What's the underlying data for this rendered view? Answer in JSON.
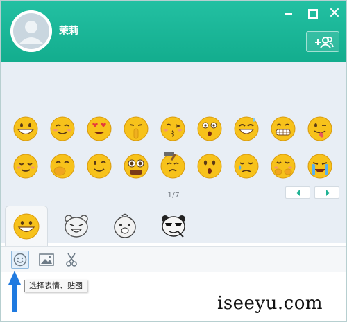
{
  "header": {
    "username": "茉莉",
    "colors": {
      "header_top": "#23c0a2",
      "header_bottom": "#13ad8e"
    },
    "icons": [
      "minimize-icon",
      "maximize-icon",
      "close-icon",
      "add-friend-icon"
    ]
  },
  "emoji_panel": {
    "rows": [
      [
        "grin",
        "smile",
        "heart-eyes",
        "shush",
        "kiss",
        "surprised",
        "laugh-sweat",
        "grimace",
        "tongue-wink"
      ],
      [
        "relieved",
        "hand-over-mouth",
        "wink",
        "dizzy-eyes",
        "hammer",
        "astonished",
        "crying",
        "shy",
        "sobbing"
      ]
    ],
    "page_indicator": "1/7"
  },
  "tabs": [
    "emoji-faces",
    "bear-sticker",
    "chick-sticker",
    "panda-sticker"
  ],
  "toolbar": {
    "tools": [
      "emoji-icon",
      "image-icon",
      "scissors-icon"
    ],
    "tooltip": "选择表情、贴图"
  },
  "watermark": "iseeyu.com"
}
